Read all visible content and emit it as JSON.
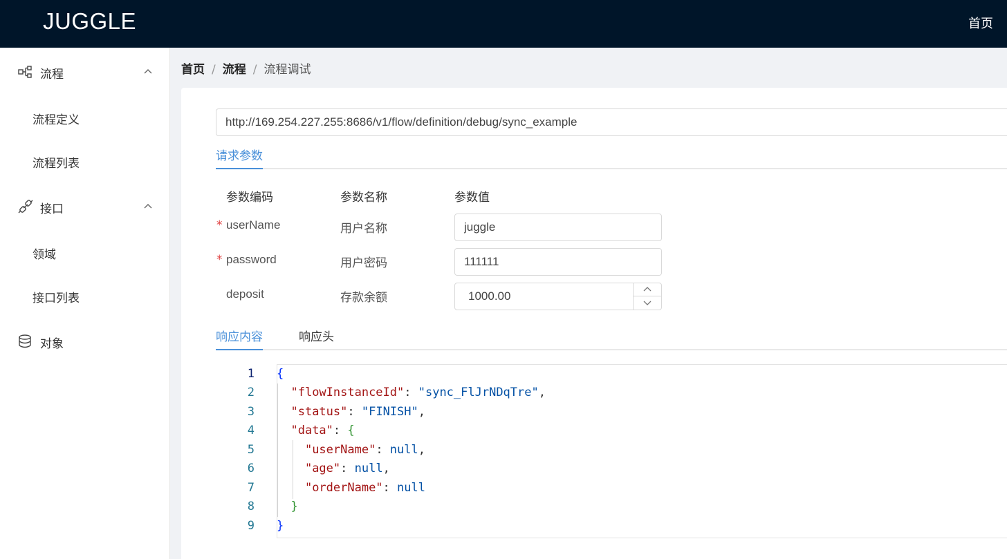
{
  "header": {
    "logo": "JUGGLE",
    "home_link": "首页"
  },
  "sidebar": {
    "groups": [
      {
        "label": "流程",
        "icon": "flow-icon",
        "expanded": true,
        "items": [
          "流程定义",
          "流程列表"
        ]
      },
      {
        "label": "接口",
        "icon": "api-link-icon",
        "expanded": true,
        "items": [
          "领域",
          "接口列表"
        ]
      },
      {
        "label": "对象",
        "icon": "database-icon",
        "expanded": false,
        "items": []
      }
    ]
  },
  "breadcrumb": [
    "首页",
    "流程",
    "流程调试"
  ],
  "url": "http://169.254.227.255:8686/v1/flow/definition/debug/sync_example",
  "request_tab": "请求参数",
  "params": {
    "headers": [
      "参数编码",
      "参数名称",
      "参数值"
    ],
    "rows": [
      {
        "code": "userName",
        "name": "用户名称",
        "value": "juggle",
        "required": true
      },
      {
        "code": "password",
        "name": "用户密码",
        "value": "111111",
        "required": true
      },
      {
        "code": "deposit",
        "name": "存款余额",
        "value": "1000.00",
        "required": false
      }
    ],
    "required_mark": "*"
  },
  "response_tabs": [
    "响应内容",
    "响应头"
  ],
  "response": {
    "line_numbers": [
      "1",
      "2",
      "3",
      "4",
      "5",
      "6",
      "7",
      "8",
      "9"
    ],
    "lines": [
      "{",
      "  \"flowInstanceId\": \"sync_FlJrNDqTre\",",
      "  \"status\": \"FINISH\",",
      "  \"data\": {",
      "    \"userName\": null,",
      "    \"age\": null,",
      "    \"orderName\": null",
      "  }",
      "}"
    ]
  },
  "colors": {
    "header_bg": "#001529",
    "accent": "#4a90d9",
    "required": "#e04040",
    "json_key": "#a31515",
    "json_value": "#0451a5"
  }
}
